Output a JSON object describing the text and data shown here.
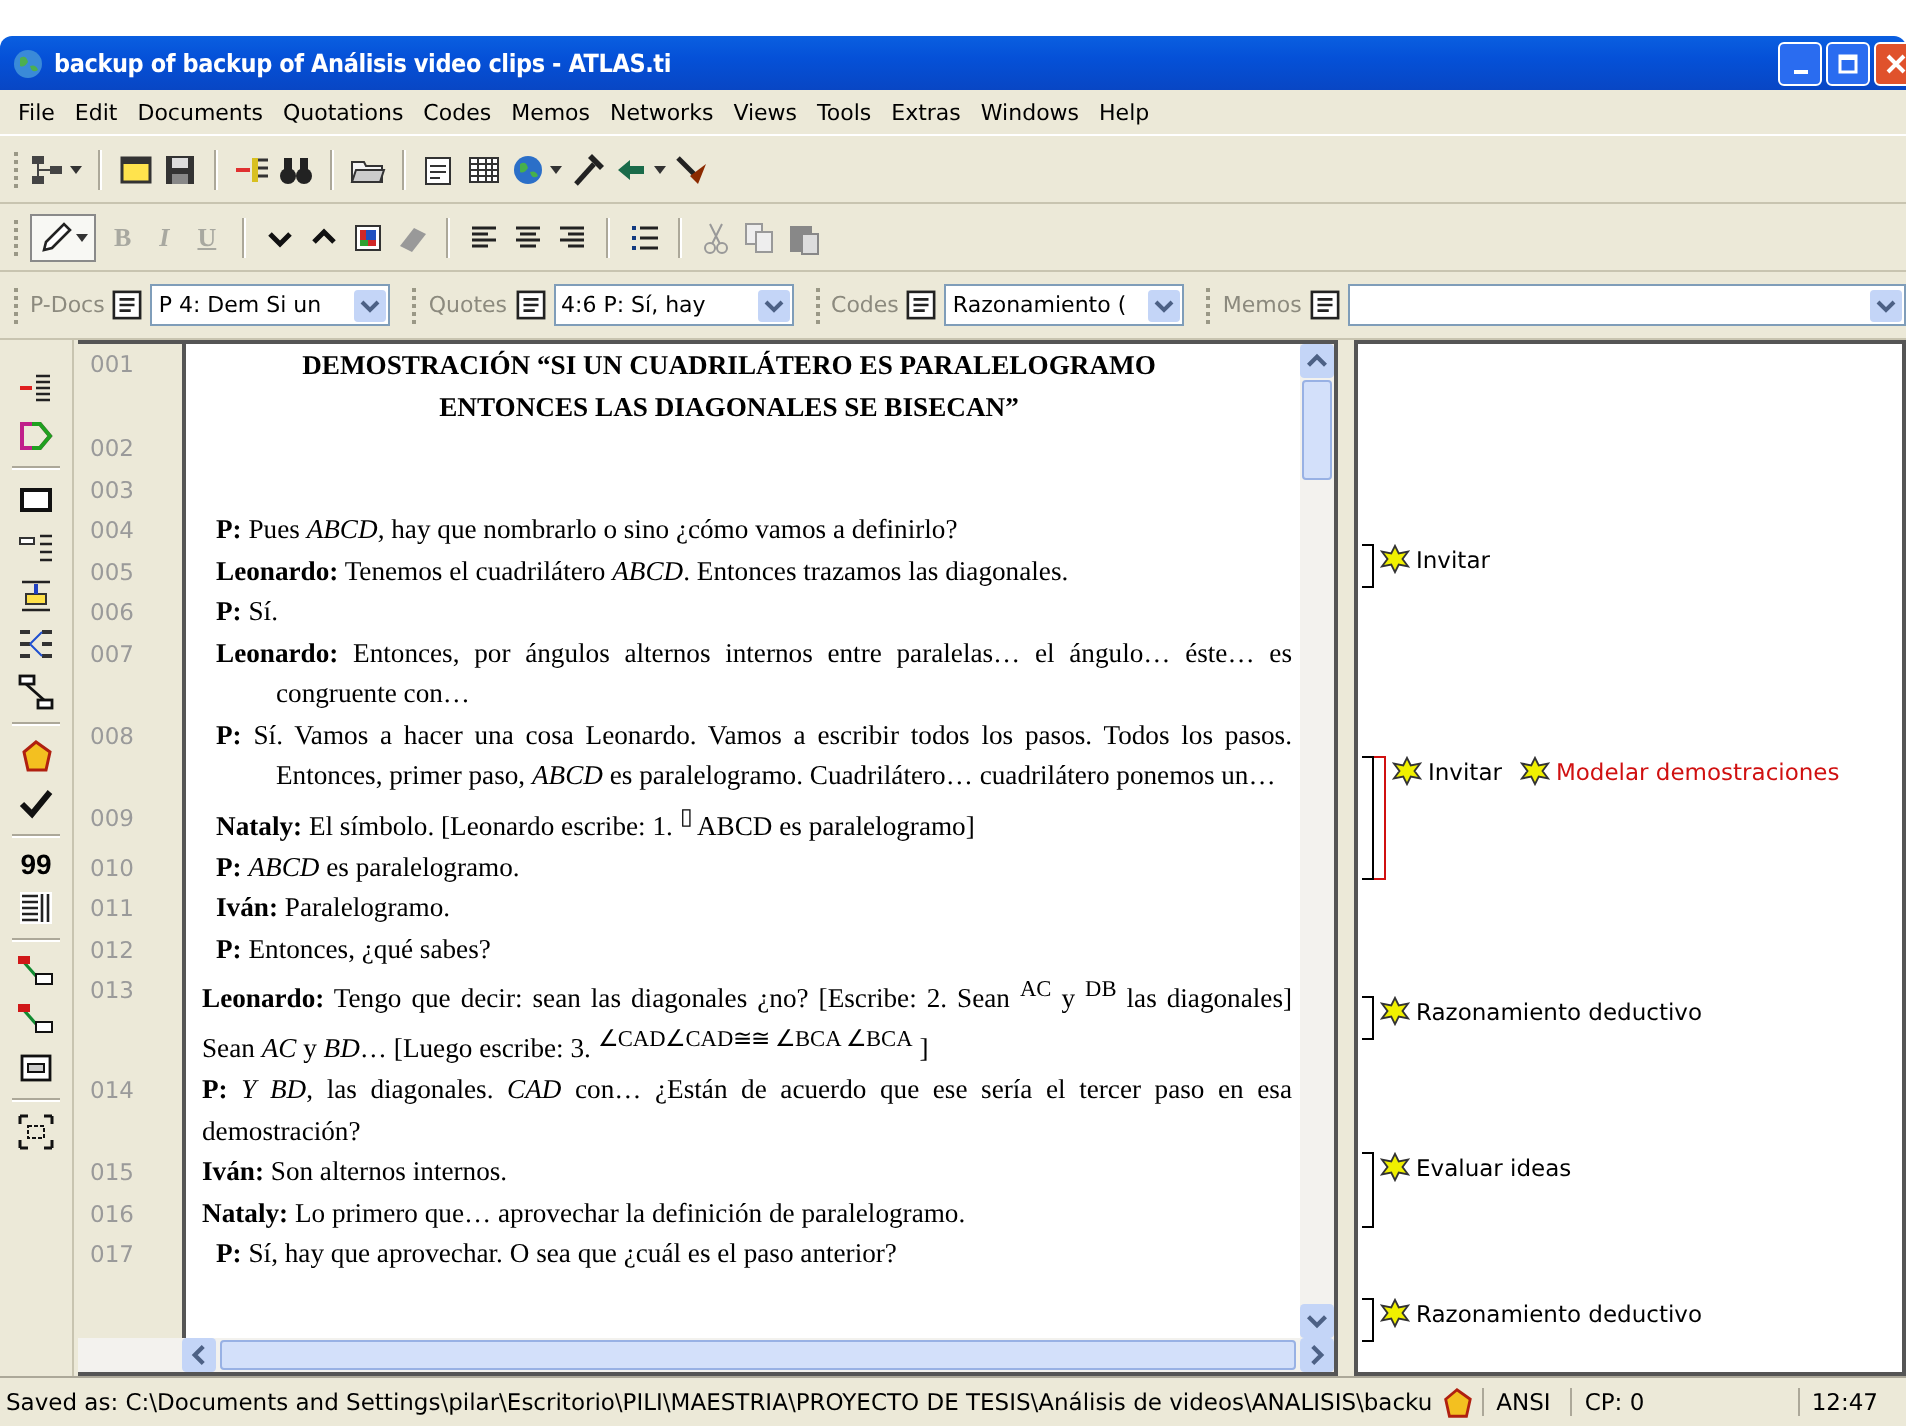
{
  "window": {
    "title": "backup of backup of Análisis video clips - ATLAS.ti"
  },
  "menu": [
    "File",
    "Edit",
    "Documents",
    "Quotations",
    "Codes",
    "Memos",
    "Networks",
    "Views",
    "Tools",
    "Extras",
    "Windows",
    "Help"
  ],
  "format_buttons": [
    {
      "label": "B",
      "disabled": true
    },
    {
      "label": "I",
      "disabled": true
    },
    {
      "label": "U",
      "disabled": true
    }
  ],
  "selectors": [
    {
      "label": "P-Docs",
      "value": "P 4: Dem Si un"
    },
    {
      "label": "Quotes",
      "value": "4:6 P: Sí, hay"
    },
    {
      "label": "Codes",
      "value": "Razonamiento ("
    },
    {
      "label": "Memos"
    }
  ],
  "document": {
    "title": "DEMOSTRACIÓN “SI UN CUADRILÁTERO ES PARALELOGRAMO ENTONCES LAS DIAGONALES SE BISECAN”",
    "title_number": "001",
    "rows": [
      {
        "number": "002"
      },
      {
        "number": "003"
      },
      {
        "number": "004",
        "text": "**P:** Pues *ABCD,* hay que nombrarlo o sino ¿cómo vamos a definirlo?",
        "hanging": true
      },
      {
        "number": "005",
        "text": "**Leonardo:** Tenemos el cuadrilátero *ABCD*. Entonces trazamos las diagonales.",
        "hanging": true
      },
      {
        "number": "006",
        "text": "**P:** Sí.",
        "hanging": true
      },
      {
        "number": "007",
        "text": "**Leonardo:** Entonces, por ángulos alternos internos entre paralelas… el ángulo… éste… es congruente con…",
        "hanging": true
      },
      {
        "number": "008",
        "text": "**P:** Sí. Vamos a hacer una cosa Leonardo. Vamos a escribir todos los pasos. Todos los pasos. Entonces, primer paso, *ABCD* es paralelogramo. Cuadrilátero… cuadrilátero ponemos un…",
        "hanging": true
      },
      {
        "number": "009",
        "text": "**Nataly:** El símbolo. [Leonardo escribe: 1. $^{▯}$ ABCD es paralelogramo]",
        "hanging": true
      },
      {
        "number": "010",
        "text": "**P:** *ABCD* es paralelogramo.",
        "hanging": true
      },
      {
        "number": "011",
        "text": "**Iván:** Paralelogramo.",
        "hanging": true
      },
      {
        "number": "012",
        "text": "**P:** Entonces, ¿qué sabes?",
        "hanging": true
      },
      {
        "number": "013",
        "text": "**Leonardo:** Tengo que decir: sean las diagonales ¿no? [Escribe: 2. Sean $^{AC}$ y $^{DB}$ las diagonales] Sean *AC* y *BD*… [Luego escribe: 3. $^{∠CAD∠CAD≅≅ ∠BCA ∠BCA}$ ]",
        "hanging": false
      },
      {
        "number": "014",
        "text": "**P:** *Y BD*, las diagonales. *CAD* con… ¿Están de acuerdo que ese sería el tercer paso en esa demostración?",
        "hanging": false
      },
      {
        "number": "015",
        "text": "**Iván:** Son alternos internos.",
        "hanging": false
      },
      {
        "number": "016",
        "text": "**Nataly:** Lo primero que… aprovechar la definición de paralelogramo.",
        "hanging": false
      },
      {
        "number": "017",
        "text": "**P:** Sí, hay que aprovechar. O sea que ¿cuál es el paso anterior?",
        "hanging": true
      }
    ]
  },
  "margin_codes": [
    {
      "codes": [
        {
          "name": "Invitar",
          "color": "#000000"
        }
      ]
    },
    {
      "codes": [
        {
          "name": "Invitar",
          "color": "#000000"
        },
        {
          "name": "Modelar demostraciones",
          "color": "#d01010"
        }
      ]
    },
    {
      "codes": [
        {
          "name": "Razonamiento deductivo",
          "color": "#000000"
        }
      ]
    },
    {
      "codes": [
        {
          "name": "Evaluar ideas",
          "color": "#000000"
        }
      ]
    },
    {
      "codes": [
        {
          "name": "Razonamiento deductivo",
          "color": "#000000"
        }
      ]
    }
  ],
  "left_toolbar_text": "99",
  "status_bar": {
    "path": "Saved as: C:\\Documents and Settings\\pilar\\Escritorio\\PILI\\MAESTRIA\\PROYECTO DE TESIS\\Análisis de videos\\ANALISIS\\backu",
    "encoding": "ANSI",
    "codepage": "CP: 0",
    "time": "12:47"
  }
}
